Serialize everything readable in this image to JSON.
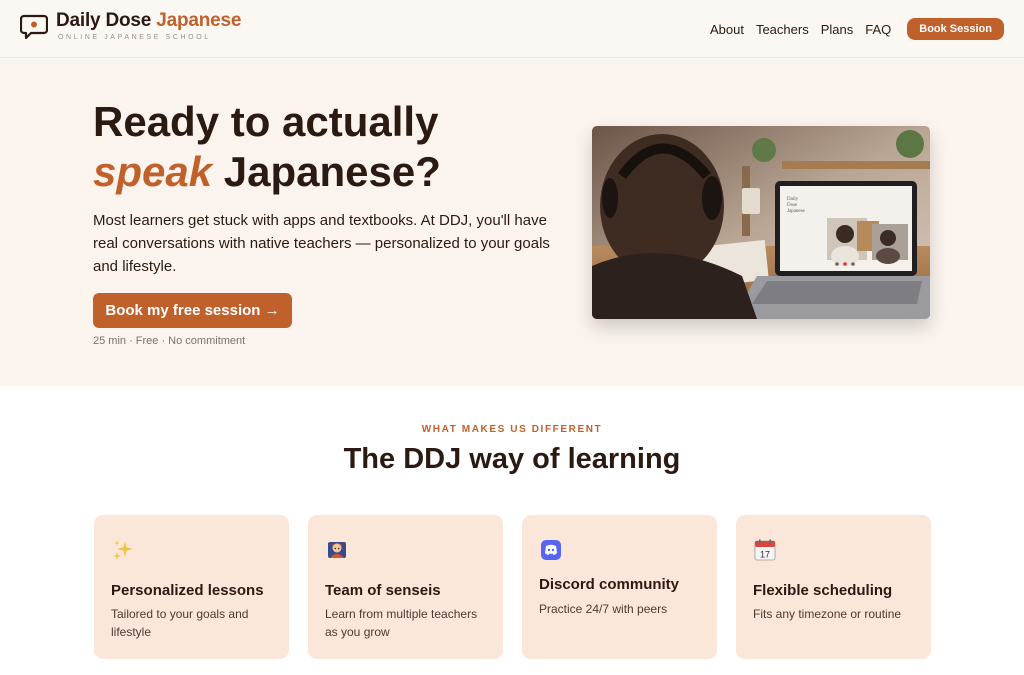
{
  "brand": {
    "name_part1": "Daily Dose",
    "name_part2": "Japanese",
    "tagline": "ONLINE JAPANESE SCHOOL",
    "accent_color": "#c0612b"
  },
  "nav": {
    "links": [
      "About",
      "Teachers",
      "Plans",
      "FAQ"
    ],
    "cta_label": "Book Session"
  },
  "hero": {
    "title_line1": "Ready to actually",
    "title_emph": "speak",
    "title_line2_rest": " Japanese?",
    "description": "Most learners get stuck with apps and textbooks. At DDJ, you'll have real conversations with native teachers — personalized to your goals and lifestyle.",
    "button_label": "Book my free session →",
    "meta": "25 min · Free · No commitment"
  },
  "features": {
    "eyebrow": "WHAT MAKES US DIFFERENT",
    "title": "The DDJ way of learning",
    "cards": [
      {
        "icon": "sparkles-icon",
        "title": "Personalized lessons",
        "desc": "Tailored to your goals and lifestyle"
      },
      {
        "icon": "teacher-icon",
        "title": "Team of senseis",
        "desc": "Learn from multiple teachers as you grow"
      },
      {
        "icon": "discord-icon",
        "title": "Discord community",
        "desc": "Practice 24/7 with peers"
      },
      {
        "icon": "calendar-icon",
        "title": "Flexible scheduling",
        "desc": "Fits any timezone or routine",
        "calendar_day": "17"
      }
    ]
  }
}
